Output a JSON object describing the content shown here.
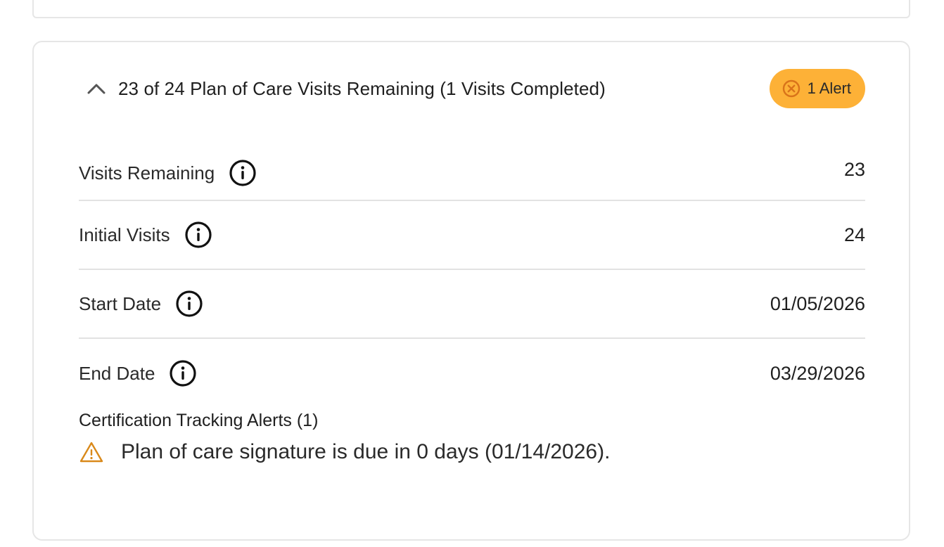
{
  "plan": {
    "title": "23 of 24 Plan of Care Visits Remaining (1 Visits Completed)",
    "alert_badge": "1 Alert",
    "rows": [
      {
        "label": "Visits Remaining",
        "value": "23"
      },
      {
        "label": "Initial Visits",
        "value": "24"
      },
      {
        "label": "Start Date",
        "value": "01/05/2026"
      },
      {
        "label": "End Date",
        "value": "03/29/2026"
      }
    ],
    "alerts_title": "Certification Tracking Alerts (1)",
    "alerts": [
      {
        "text": "Plan of care signature is due in 0 days (01/14/2026)."
      }
    ]
  },
  "icons": {
    "collapse": "chevron-up-icon",
    "badge": "x-circle-icon",
    "info": "info-icon",
    "warning": "warning-triangle-icon"
  },
  "colors": {
    "badge_bg": "#fdb137",
    "badge_icon": "#d9731a",
    "warning": "#d9891a",
    "border": "#e6e6e6"
  }
}
